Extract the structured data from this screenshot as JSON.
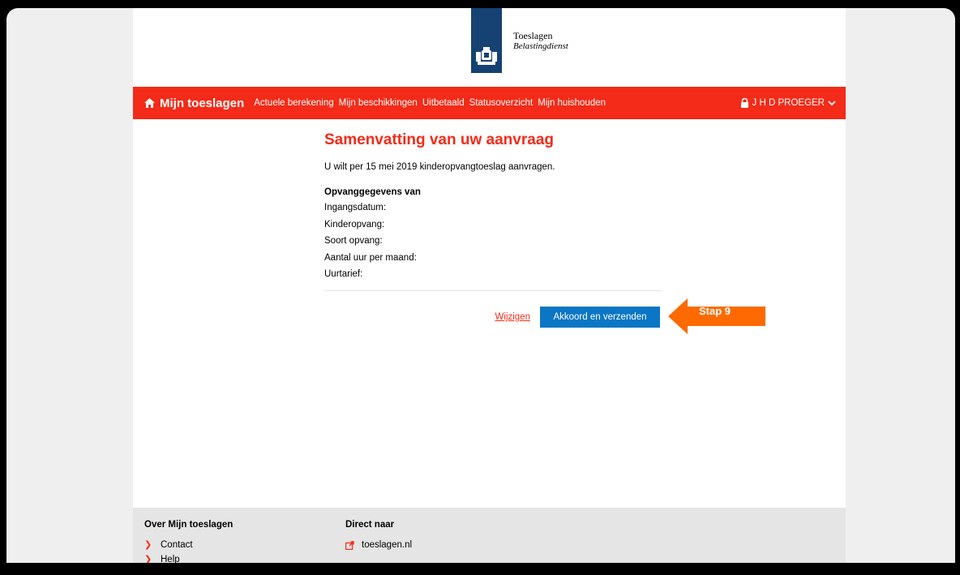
{
  "header": {
    "logo_title": "Toeslagen",
    "logo_subtitle": "Belastingdienst"
  },
  "nav": {
    "home_label": "Mijn toeslagen",
    "links": [
      "Actuele berekening",
      "Mijn beschikkingen",
      "Uitbetaald",
      "Statusoverzicht",
      "Mijn huishouden"
    ],
    "user_name": "J H D PROEGER"
  },
  "main": {
    "heading": "Samenvatting van uw aanvraag",
    "intro": "U wilt per 15 mei 2019 kinderopvangtoeslag aanvragen.",
    "section_title": "Opvanggegevens van",
    "fields": [
      "Ingangsdatum:",
      "Kinderopvang:",
      "Soort opvang:",
      "Aantal uur per maand:",
      "Uurtarief:"
    ],
    "edit_label": "Wijzigen",
    "submit_label": "Akkoord en verzenden"
  },
  "annotation": {
    "label": "Stap 9",
    "color": "#ff6a00"
  },
  "footer": {
    "col1_title": "Over Mijn toeslagen",
    "col1_items": [
      "Contact",
      "Help"
    ],
    "col2_title": "Direct naar",
    "col2_items": [
      "toeslagen.nl"
    ]
  },
  "colors": {
    "brand_red": "#f32b18",
    "primary_blue": "#0b76c5",
    "logo_blue": "#154273"
  }
}
